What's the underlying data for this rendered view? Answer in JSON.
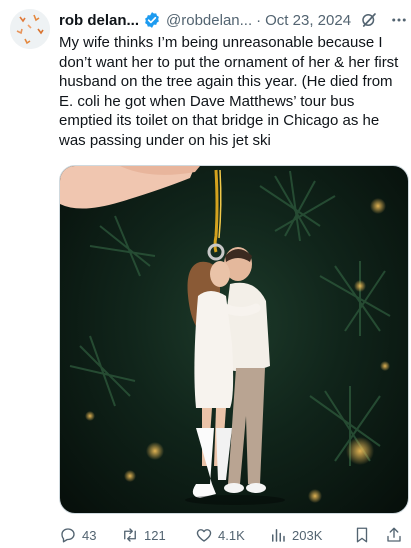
{
  "author": {
    "name": "rob delan...",
    "handle": "@robdelan...",
    "separator": "·",
    "date": "Oct 23, 2024"
  },
  "tweet": {
    "text": "My wife thinks I’m being unreasonable because I don’t want her to put the ornament of her & her first husband on the tree again this year. (He died from E. coli he got when Dave Matthews’ tour bus emptied its toilet on that bridge in Chicago as he was passing under on his jet ski"
  },
  "icons": {
    "verified": "verified-badge-icon",
    "grok": "grok-icon",
    "more": "more-icon",
    "reply": "reply-icon",
    "retweet": "retweet-icon",
    "like": "heart-icon",
    "views": "views-icon",
    "bookmark": "bookmark-icon",
    "share": "share-icon"
  },
  "colors": {
    "text": "#0f1419",
    "secondary": "#536471",
    "verified": "#1d9bf0",
    "border": "#cfd9de"
  },
  "stats": {
    "replies": "43",
    "retweets": "121",
    "likes": "4.1K",
    "views": "203K"
  }
}
